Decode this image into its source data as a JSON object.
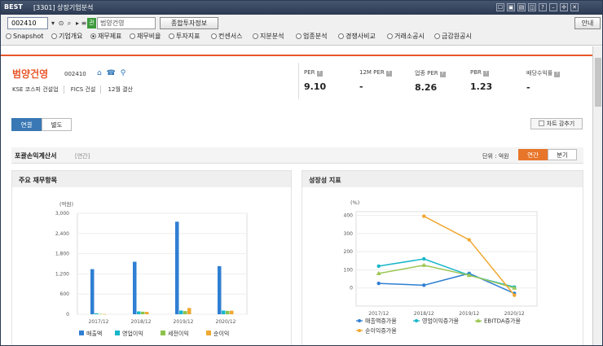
{
  "window": {
    "logo": "BEST",
    "title": "[3301] 상장기업분석",
    "controls": [
      "☐",
      "▣",
      "▤",
      "◫",
      "?",
      "–",
      "✢",
      "✕"
    ]
  },
  "toolbar": {
    "code": "002410",
    "name_placeholder": "범양건영",
    "company_info_button": "종합투자정보",
    "guide_button": "안내",
    "badge": "관"
  },
  "radios": [
    {
      "label": "Snapshot",
      "selected": false
    },
    {
      "label": "기업개요",
      "selected": false
    },
    {
      "label": "재무제표",
      "selected": true
    },
    {
      "label": "재무비율",
      "selected": false
    },
    {
      "label": "투자지표",
      "selected": false
    },
    {
      "label": "컨센서스",
      "selected": false
    },
    {
      "label": "지분분석",
      "selected": false
    },
    {
      "label": "업종분석",
      "selected": false
    },
    {
      "label": "경쟁사비교",
      "selected": false
    },
    {
      "label": "거래소공시",
      "selected": false
    },
    {
      "label": "금감원공시",
      "selected": false
    }
  ],
  "company": {
    "name": "범양건영",
    "code": "002410",
    "info": [
      "KSE 코스피 건설업",
      "FICS 건설",
      "12월 결산"
    ]
  },
  "metrics": [
    {
      "label": "PER",
      "value": "9.10"
    },
    {
      "label": "12M PER",
      "value": "-"
    },
    {
      "label": "업종 PER",
      "value": "8.26"
    },
    {
      "label": "PBR",
      "value": "1.23"
    },
    {
      "label": "배당수익률",
      "value": "-"
    }
  ],
  "tabs": [
    {
      "label": "연결",
      "active": true
    },
    {
      "label": "별도",
      "active": false
    }
  ],
  "chart_toggle": "차트 감추기",
  "section": {
    "title": "포괄손익계산서",
    "subtitle": "[연간]",
    "unit": "단위 : 억원",
    "periods": [
      {
        "label": "연간",
        "active": true
      },
      {
        "label": "분기",
        "active": false
      }
    ]
  },
  "panels": {
    "left_title": "주요 재무항목",
    "right_title": "성장성 지표"
  },
  "colors": {
    "accent": "#e8562a",
    "sales": "#2f7fd3",
    "op": "#17b6c9",
    "pretax": "#8cc34a",
    "net": "#f0a830",
    "ebitda": "#9bc653"
  },
  "chart_data": [
    {
      "type": "bar",
      "ylabel": "(억원)",
      "ylim": [
        0,
        3000
      ],
      "yticks": [
        "0",
        "600",
        "1,200",
        "1,800",
        "2,400",
        "3,000"
      ],
      "categories": [
        "2017/12",
        "2018/12",
        "2019/12",
        "2020/12"
      ],
      "series": [
        {
          "name": "매출액",
          "color": "#2f7fd3",
          "values": [
            1340,
            1560,
            2750,
            1430
          ]
        },
        {
          "name": "영업이익",
          "color": "#17b6c9",
          "values": [
            30,
            85,
            110,
            110
          ]
        },
        {
          "name": "세전이익",
          "color": "#8cc34a",
          "values": [
            10,
            75,
            95,
            100
          ]
        },
        {
          "name": "순이익",
          "color": "#f0a830",
          "values": [
            5,
            70,
            185,
            105
          ]
        }
      ]
    },
    {
      "type": "line",
      "ylabel": "(%)",
      "ylim": [
        -100,
        420
      ],
      "yticks": [
        "0",
        "100",
        "200",
        "300",
        "400"
      ],
      "categories": [
        "2017/12",
        "2018/12",
        "2019/12",
        "2020/12"
      ],
      "series": [
        {
          "name": "매출액증가율",
          "color": "#2f7fd3",
          "marker": "circle",
          "values": [
            25,
            15,
            80,
            -30
          ]
        },
        {
          "name": "영업이익증가율",
          "color": "#17b6c9",
          "marker": "circle",
          "values": [
            120,
            160,
            70,
            5
          ]
        },
        {
          "name": "EBITDA증가율",
          "color": "#9bc653",
          "marker": "triangle",
          "values": [
            80,
            125,
            70,
            0
          ]
        },
        {
          "name": "순이익증가율",
          "color": "#f0a830",
          "marker": "circle",
          "values": [
            null,
            395,
            265,
            -40
          ]
        }
      ]
    }
  ]
}
